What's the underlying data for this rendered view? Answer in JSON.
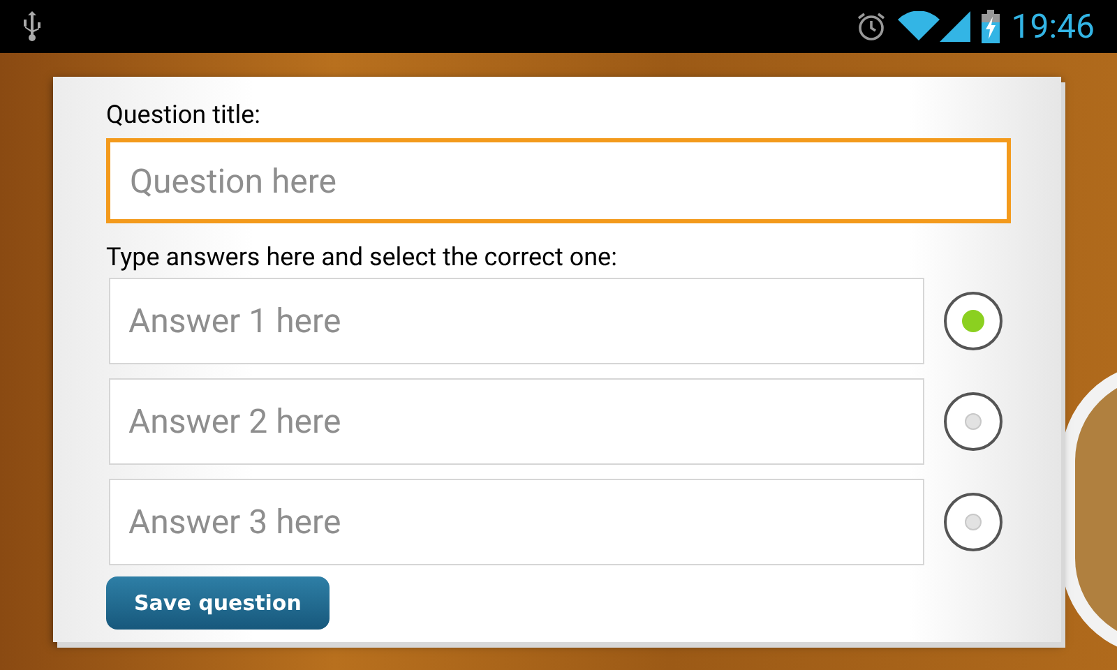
{
  "status_bar": {
    "time": "19:46"
  },
  "form": {
    "question_label": "Question title:",
    "question_field": {
      "placeholder": "Question here",
      "focused": true
    },
    "answers_label": "Type answers here and select the correct one:",
    "answers": [
      {
        "placeholder": "Answer 1 here",
        "selected": true
      },
      {
        "placeholder": "Answer 2 here",
        "selected": false
      },
      {
        "placeholder": "Answer 3 here",
        "selected": false
      }
    ],
    "save_button": "Save question"
  }
}
